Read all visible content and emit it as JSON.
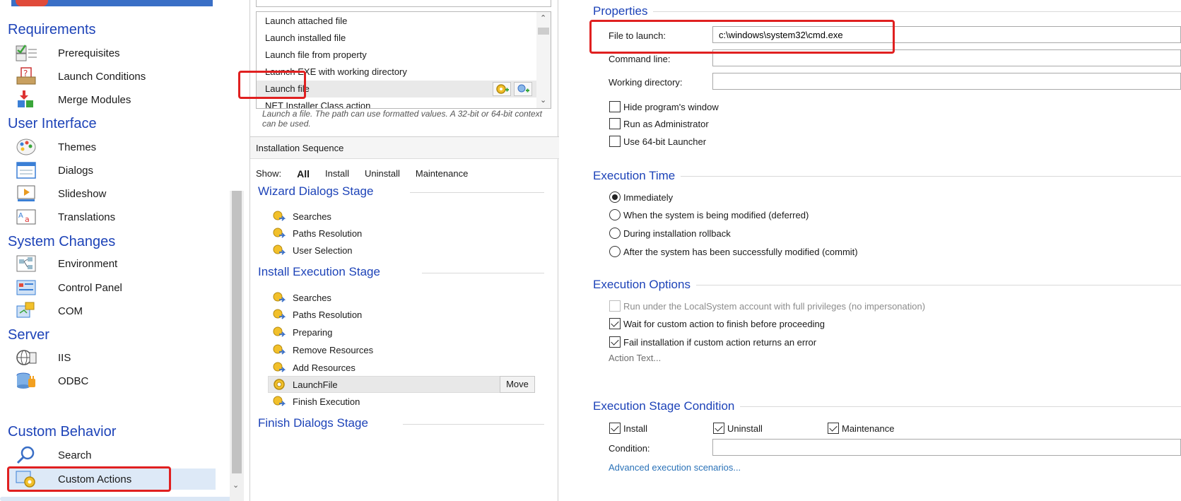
{
  "sidebar": {
    "sections": [
      {
        "title": "Requirements",
        "items": [
          {
            "label": "Prerequisites",
            "icon": "prerequisites-icon"
          },
          {
            "label": "Launch Conditions",
            "icon": "launch-conditions-icon"
          },
          {
            "label": "Merge Modules",
            "icon": "merge-modules-icon"
          }
        ]
      },
      {
        "title": "User Interface",
        "items": [
          {
            "label": "Themes",
            "icon": "themes-icon"
          },
          {
            "label": "Dialogs",
            "icon": "dialogs-icon"
          },
          {
            "label": "Slideshow",
            "icon": "slideshow-icon"
          },
          {
            "label": "Translations",
            "icon": "translations-icon"
          }
        ]
      },
      {
        "title": "System Changes",
        "items": [
          {
            "label": "Environment",
            "icon": "environment-icon"
          },
          {
            "label": "Control Panel",
            "icon": "control-panel-icon"
          },
          {
            "label": "COM",
            "icon": "com-icon"
          }
        ]
      },
      {
        "title": "Server",
        "items": [
          {
            "label": "IIS",
            "icon": "iis-icon"
          },
          {
            "label": "ODBC",
            "icon": "odbc-icon"
          }
        ]
      },
      {
        "title": "Custom Behavior",
        "items": [
          {
            "label": "Search",
            "icon": "search-icon"
          },
          {
            "label": "Custom Actions",
            "icon": "custom-actions-icon"
          }
        ]
      }
    ],
    "selected": "Custom Actions"
  },
  "actions": {
    "items": [
      "Launch attached file",
      "Launch installed file",
      "Launch file from property",
      "Launch EXE with working directory",
      "Launch file",
      "NET Installer Class action"
    ],
    "selected": "Launch file",
    "description": "Launch a file. The path can use formatted values. A 32-bit or 64-bit context can be used."
  },
  "sequence": {
    "header": "Installation Sequence",
    "show_label": "Show:",
    "filters": [
      "All",
      "Install",
      "Uninstall",
      "Maintenance"
    ],
    "active_filter": "All",
    "stages": [
      {
        "title": "Wizard Dialogs Stage",
        "items": [
          "Searches",
          "Paths Resolution",
          "User Selection"
        ]
      },
      {
        "title": "Install Execution Stage",
        "items": [
          "Searches",
          "Paths Resolution",
          "Preparing",
          "Remove Resources",
          "Add Resources",
          "LaunchFile",
          "Finish Execution"
        ]
      },
      {
        "title": "Finish Dialogs Stage",
        "items": []
      }
    ],
    "selected_item": "LaunchFile",
    "move_label": "Move"
  },
  "properties": {
    "title": "Properties",
    "file_to_launch_label": "File to launch:",
    "file_to_launch_value": "c:\\windows\\system32\\cmd.exe",
    "command_line_label": "Command line:",
    "command_line_value": "",
    "working_dir_label": "Working directory:",
    "working_dir_value": "",
    "checkboxes": [
      {
        "label": "Hide program's window",
        "checked": false
      },
      {
        "label": "Run as Administrator",
        "checked": false
      },
      {
        "label": "Use 64-bit Launcher",
        "checked": false
      }
    ]
  },
  "execution_time": {
    "title": "Execution Time",
    "options": [
      {
        "label": "Immediately",
        "checked": true
      },
      {
        "label": "When the system is being modified (deferred)",
        "checked": false
      },
      {
        "label": "During installation rollback",
        "checked": false
      },
      {
        "label": "After the system has been successfully modified (commit)",
        "checked": false
      }
    ]
  },
  "execution_options": {
    "title": "Execution Options",
    "checkboxes": [
      {
        "label": "Run under the LocalSystem account with full privileges (no impersonation)",
        "checked": false,
        "disabled": true
      },
      {
        "label": "Wait for custom action to finish before proceeding",
        "checked": true,
        "disabled": false
      },
      {
        "label": "Fail installation if custom action returns an error",
        "checked": true,
        "disabled": false
      }
    ],
    "action_text": "Action Text..."
  },
  "stage_condition": {
    "title": "Execution Stage Condition",
    "checkboxes": [
      {
        "label": "Install",
        "checked": true
      },
      {
        "label": "Uninstall",
        "checked": true
      },
      {
        "label": "Maintenance",
        "checked": true
      }
    ],
    "condition_label": "Condition:",
    "condition_value": "",
    "advanced_link": "Advanced execution scenarios..."
  },
  "colors": {
    "section_title": "#1d43b8",
    "highlight": "#e02020",
    "selection": "#dde9f7",
    "link": "#2a72b8"
  }
}
